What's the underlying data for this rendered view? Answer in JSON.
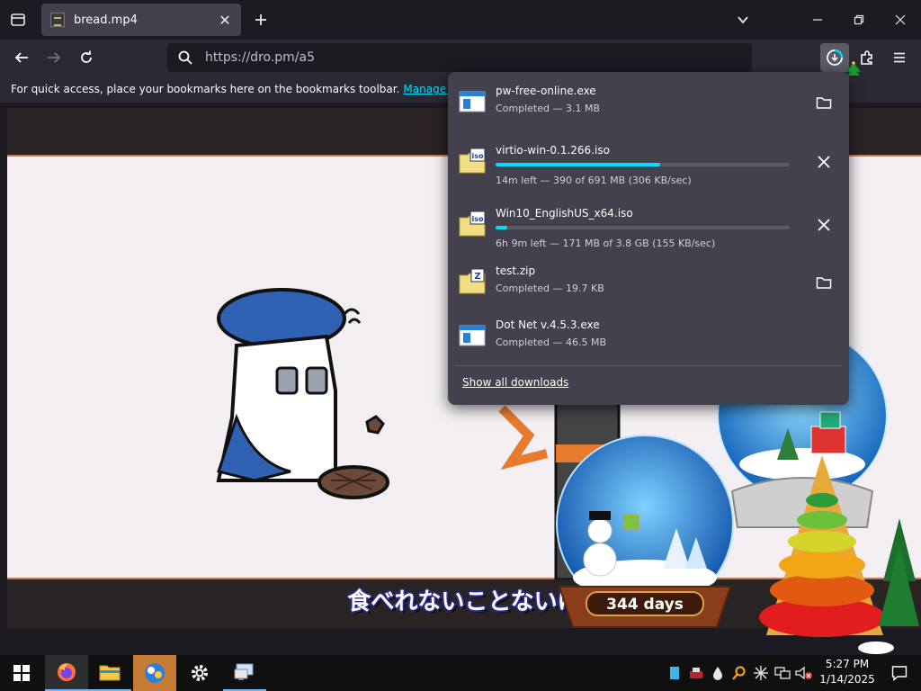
{
  "browser": {
    "tab": {
      "title": "bread.mp4"
    },
    "address": {
      "url": "https://dro.pm/a5"
    },
    "bookmarks_bar": {
      "message": "For quick access, place your bookmarks here on the bookmarks toolbar.",
      "manage_link": "Manage bookmarks"
    }
  },
  "video": {
    "subtitle": "食べれないことないけ"
  },
  "downloads": {
    "items": [
      {
        "name": "pw-free-online.exe",
        "status": "Completed — 3.1 MB",
        "icon": "exe-file-icon",
        "action": "folder-icon"
      },
      {
        "name": "virtio-win-0.1.266.iso",
        "status": "14m left — 390 of 691 MB (306 KB/sec)",
        "icon": "iso-file-icon",
        "action": "cancel-icon",
        "progress": 0.56
      },
      {
        "name": "Win10_EnglishUS_x64.iso",
        "status": "6h 9m left — 171 MB of 3.8 GB (155 KB/sec)",
        "icon": "iso-file-icon",
        "action": "cancel-icon",
        "progress": 0.04
      },
      {
        "name": "test.zip",
        "status": "Completed — 19.7 KB",
        "icon": "zip-file-icon",
        "action": "folder-icon"
      },
      {
        "name": "Dot Net v.4.5.3.exe",
        "status": "Completed — 46.5 MB",
        "icon": "exe-file-icon",
        "action": "folder-icon"
      }
    ],
    "show_all": "Show all downloads"
  },
  "desktop": {
    "snowglobe_label": "344 days"
  },
  "taskbar": {
    "time": "5:27 PM",
    "date": "1/14/2025"
  },
  "colors": {
    "accent": "#00ddff",
    "panel": "#42414d",
    "toolbar": "#2b2a33",
    "tabstrip": "#1c1b22"
  }
}
